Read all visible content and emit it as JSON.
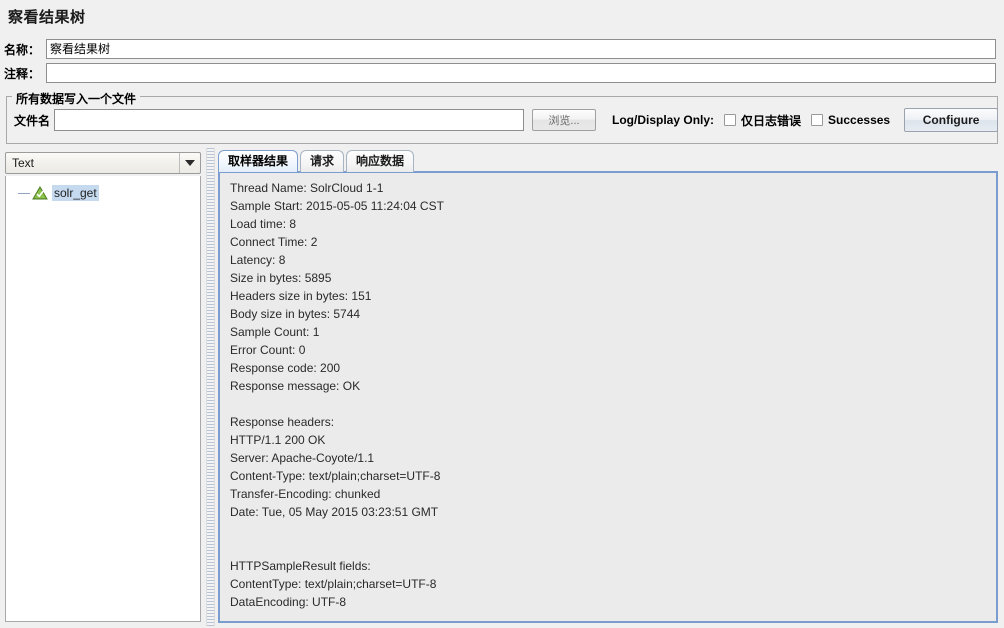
{
  "window": {
    "title": "察看结果树"
  },
  "form": {
    "name_label": "名称：",
    "name_value": "察看结果树",
    "comment_label": "注释：",
    "comment_value": ""
  },
  "file_panel": {
    "group_title": "所有数据写入一个文件",
    "filename_label": "文件名",
    "filename_value": "",
    "filename_placeholder": "",
    "browse_label": "浏览...",
    "log_display_only_label": "Log/Display Only:",
    "errors_only_label": "仅日志错误",
    "errors_only_checked": false,
    "successes_label": "Successes",
    "successes_checked": false,
    "configure_label": "Configure"
  },
  "left_pane": {
    "render_selector_value": "Text",
    "render_options": [
      "Text"
    ],
    "tree": [
      {
        "label": "solr_get",
        "status": "success",
        "selected": true
      }
    ]
  },
  "right_pane": {
    "tabs": [
      {
        "label": "取样器结果",
        "active": true
      },
      {
        "label": "请求",
        "active": false
      },
      {
        "label": "响应数据",
        "active": false
      }
    ],
    "sampler_result_lines": [
      "Thread Name: SolrCloud 1-1",
      "Sample Start: 2015-05-05 11:24:04 CST",
      "Load time: 8",
      "Connect Time: 2",
      "Latency: 8",
      "Size in bytes: 5895",
      "Headers size in bytes: 151",
      "Body size in bytes: 5744",
      "Sample Count: 1",
      "Error Count: 0",
      "Response code: 200",
      "Response message: OK",
      "",
      "Response headers:",
      "HTTP/1.1 200 OK",
      "Server: Apache-Coyote/1.1",
      "Content-Type: text/plain;charset=UTF-8",
      "Transfer-Encoding: chunked",
      "Date: Tue, 05 May 2015 03:23:51 GMT",
      "",
      "",
      "HTTPSampleResult fields:",
      "ContentType: text/plain;charset=UTF-8",
      "DataEncoding: UTF-8"
    ]
  },
  "colors": {
    "panel_background": "#f0f0f0",
    "content_background": "#ebebeb",
    "tab_border_active": "#7b9ccf",
    "tree_selection": "#c5d9ef",
    "success_icon": "#4e9a3a"
  }
}
